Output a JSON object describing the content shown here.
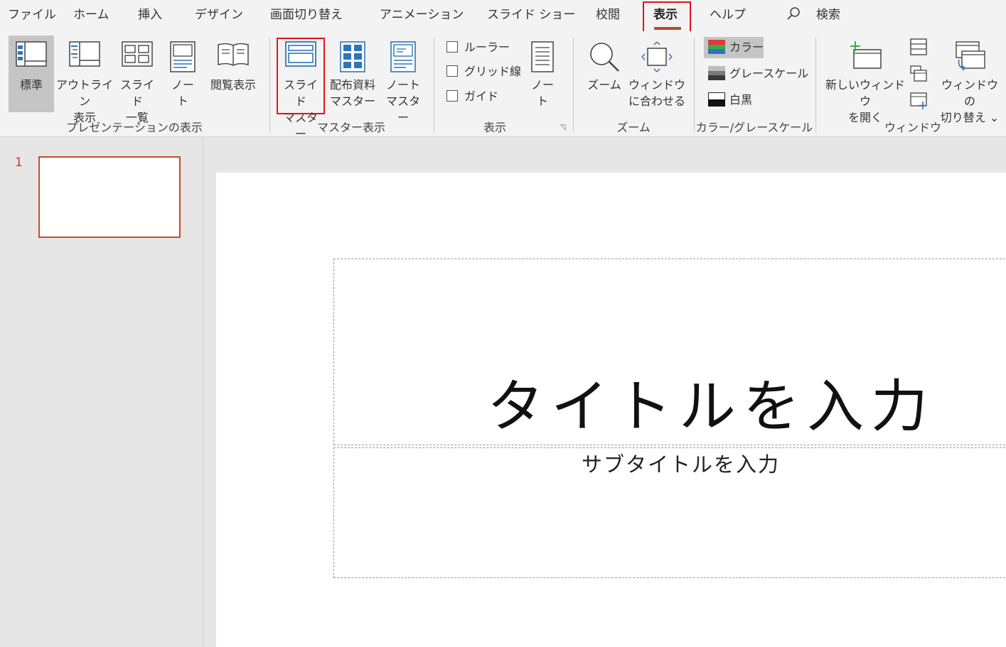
{
  "tabs": [
    "ファイル",
    "ホーム",
    "挿入",
    "デザイン",
    "画面切り替え",
    "アニメーション",
    "スライド ショー",
    "校閲",
    "表示",
    "ヘルプ"
  ],
  "active_tab": "表示",
  "search_label": "検索",
  "ribbon": {
    "presentation_views": {
      "group_label": "プレゼンテーションの表示",
      "normal": "標準",
      "outline": "アウトライン\n表示",
      "slide_sorter": "スライド\n一覧",
      "notes_page": "ノー\nト",
      "reading_view": "閲覧表示"
    },
    "master_views": {
      "group_label": "マスター表示",
      "slide_master": "スライド\nマスター",
      "handout_master": "配布資料\nマスター",
      "notes_master": "ノート\nマスター"
    },
    "show": {
      "group_label": "表示",
      "ruler": "ルーラー",
      "gridlines": "グリッド線",
      "guides": "ガイド",
      "notes": "ノー\nト"
    },
    "zoom": {
      "group_label": "ズーム",
      "zoom": "ズーム",
      "fit_to_window": "ウィンドウ\nに合わせる"
    },
    "color_grayscale": {
      "group_label": "カラー/グレースケール",
      "color": "カラー",
      "grayscale": "グレースケール",
      "black_and_white": "白黒"
    },
    "window": {
      "group_label": "ウィンドウ",
      "new_window": "新しいウィンドウ\nを開く",
      "switch_windows": "ウィンドウの\n切り替え ⌄"
    }
  },
  "thumbnails": {
    "slide_number": "1"
  },
  "slide": {
    "title_placeholder": "タイトルを入力",
    "subtitle_placeholder": "サブタイトルを入力"
  },
  "colors": {
    "accent": "#b7472a",
    "highlight_box": "#e2141b",
    "thumb_border": "#d24726",
    "icon_blue": "#2e75b6"
  }
}
